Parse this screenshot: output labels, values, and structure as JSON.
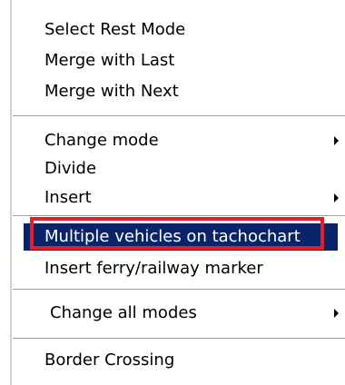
{
  "menu": {
    "items": [
      {
        "label": "Select Rest Mode"
      },
      {
        "label": "Merge with Last"
      },
      {
        "label": "Merge with Next"
      },
      {
        "label": "Change mode",
        "submenu": true
      },
      {
        "label": "Divide"
      },
      {
        "label": "Insert",
        "submenu": true
      },
      {
        "label": "Multiple vehicles on tachochart",
        "selected": true,
        "annotated": true
      },
      {
        "label": "Insert ferry/railway marker"
      },
      {
        "label": "Change all modes",
        "submenu": true
      },
      {
        "label": "Border Crossing"
      }
    ]
  },
  "colors": {
    "selection_background": "#0a246a",
    "selection_text": "#ffffff",
    "annotation_box": "#e0202a",
    "separator": "#a0a0a0"
  },
  "icons": {
    "submenu": "chevron-right-icon"
  }
}
